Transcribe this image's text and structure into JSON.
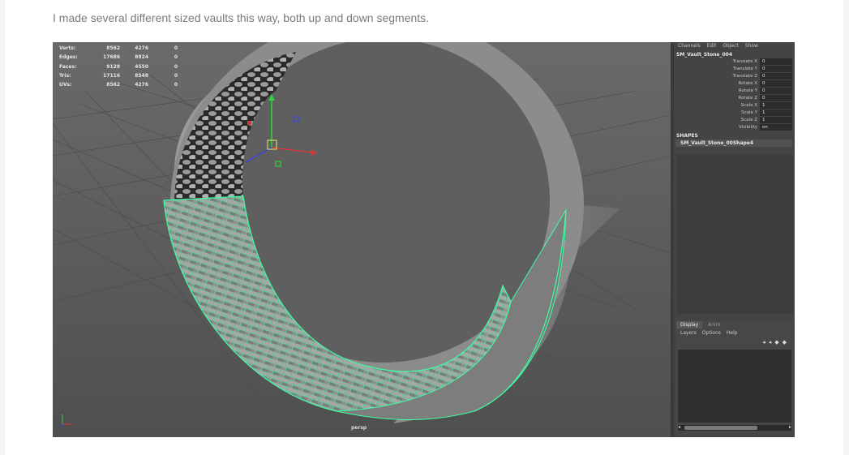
{
  "caption": "I made several different sized vaults this way, both up and down segments.",
  "viewport": {
    "hud": [
      {
        "label": "Verts:",
        "v1": "8562",
        "v2": "4276",
        "v3": "0"
      },
      {
        "label": "Edges:",
        "v1": "17686",
        "v2": "8824",
        "v3": "0"
      },
      {
        "label": "Faces:",
        "v1": "9128",
        "v2": "4550",
        "v3": "0"
      },
      {
        "label": "Tris:",
        "v1": "17116",
        "v2": "8548",
        "v3": "0"
      },
      {
        "label": "UVs:",
        "v1": "8562",
        "v2": "4276",
        "v3": "0"
      }
    ],
    "camera_label": "persp"
  },
  "channel_box": {
    "menu": [
      "Channels",
      "Edit",
      "Object",
      "Show"
    ],
    "object_name": "SM_Vault_Stone_004",
    "channels": [
      {
        "label": "Translate X",
        "value": "0"
      },
      {
        "label": "Translate Y",
        "value": "0"
      },
      {
        "label": "Translate Z",
        "value": "0"
      },
      {
        "label": "Rotate X",
        "value": "0"
      },
      {
        "label": "Rotate Y",
        "value": "0"
      },
      {
        "label": "Rotate Z",
        "value": "0"
      },
      {
        "label": "Scale X",
        "value": "1"
      },
      {
        "label": "Scale Y",
        "value": "1"
      },
      {
        "label": "Scale Z",
        "value": "1"
      },
      {
        "label": "Visibility",
        "value": "on"
      }
    ],
    "shapes_header": "SHAPES",
    "shape_item": "SM_Vault_Stone_00Shape4"
  },
  "layer_editor": {
    "tabs": [
      "Display",
      "Anim"
    ],
    "menu": [
      "Layers",
      "Options",
      "Help"
    ]
  },
  "colors": {
    "selection_wire": "#3dffa0",
    "viewport_bg": "#5f5f5f",
    "panel_bg": "#444444"
  }
}
